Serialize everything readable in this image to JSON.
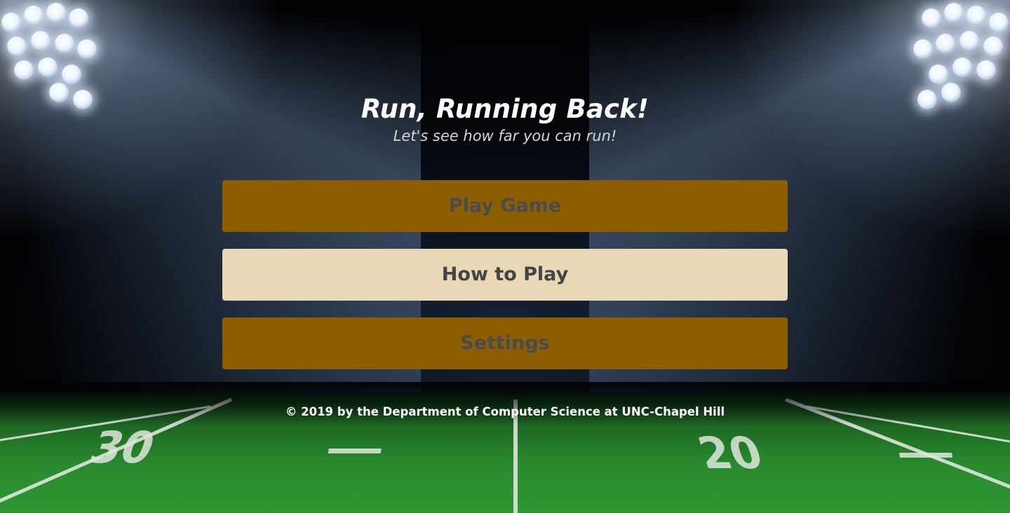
{
  "header": {
    "title": "Run, Running Back!",
    "subtitle": "Let's see how far you can run!"
  },
  "menu": {
    "play_label": "Play Game",
    "howto_label": "How to Play",
    "settings_label": "Settings"
  },
  "footer": {
    "copyright": "© 2019 by the Department of Computer Science at UNC-Chapel Hill"
  },
  "field": {
    "yard_left": "30",
    "yard_right": "20"
  },
  "colors": {
    "button_gold": "#8c5e00",
    "button_cream": "#e8d8b6",
    "button_text": "#4a4a4a",
    "title_text": "#ffffff"
  }
}
